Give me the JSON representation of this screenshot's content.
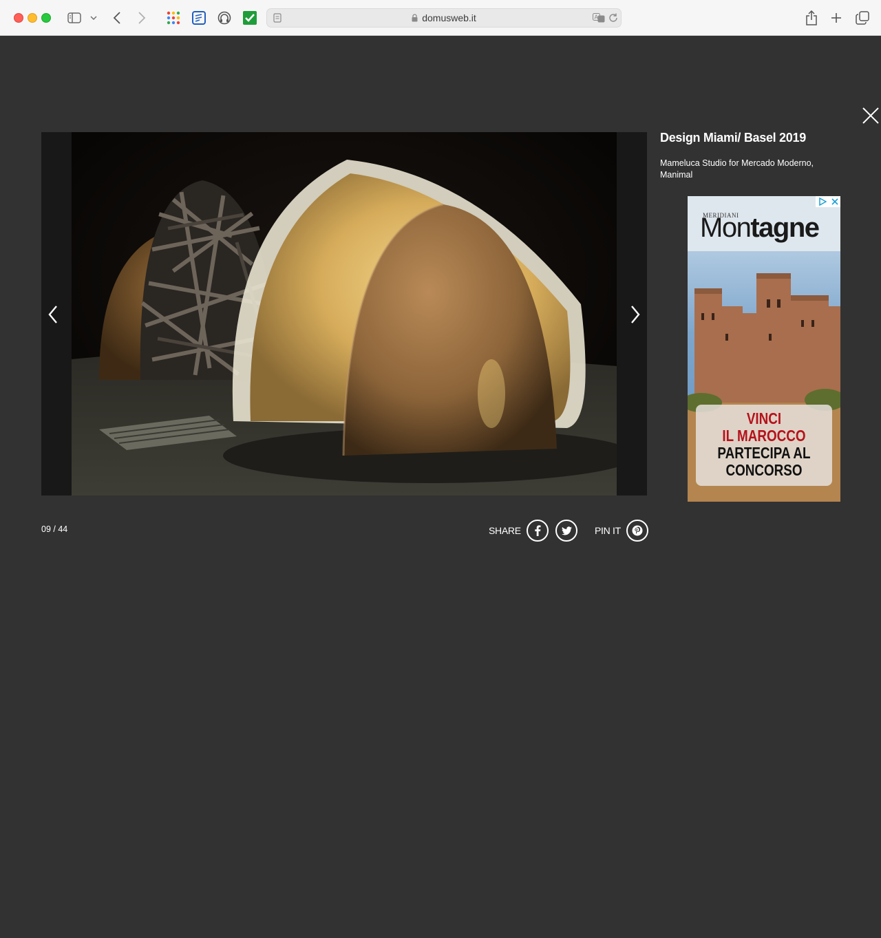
{
  "browser": {
    "url": "domusweb.it"
  },
  "gallery": {
    "title": "Design Miami/ Basel 2019",
    "caption": "Mameluca Studio for Mercado Moderno, Manimal",
    "counter": "09 / 44",
    "share_label": "SHARE",
    "pin_label": "PIN IT",
    "photo_alt": "Sculptural huts made of straw, metal strips, wool and fur",
    "icons": [
      "close-icon",
      "chevron-left-icon",
      "chevron-right-icon",
      "facebook-icon",
      "twitter-icon",
      "pinterest-icon"
    ]
  },
  "ad": {
    "brand_small": "MERIDIANI",
    "brand_thin": "Mon",
    "brand_bold": "tagne",
    "line1": "VINCI",
    "line2": "IL MAROCCO",
    "line3": "PARTECIPA AL",
    "line4": "CONCORSO"
  }
}
